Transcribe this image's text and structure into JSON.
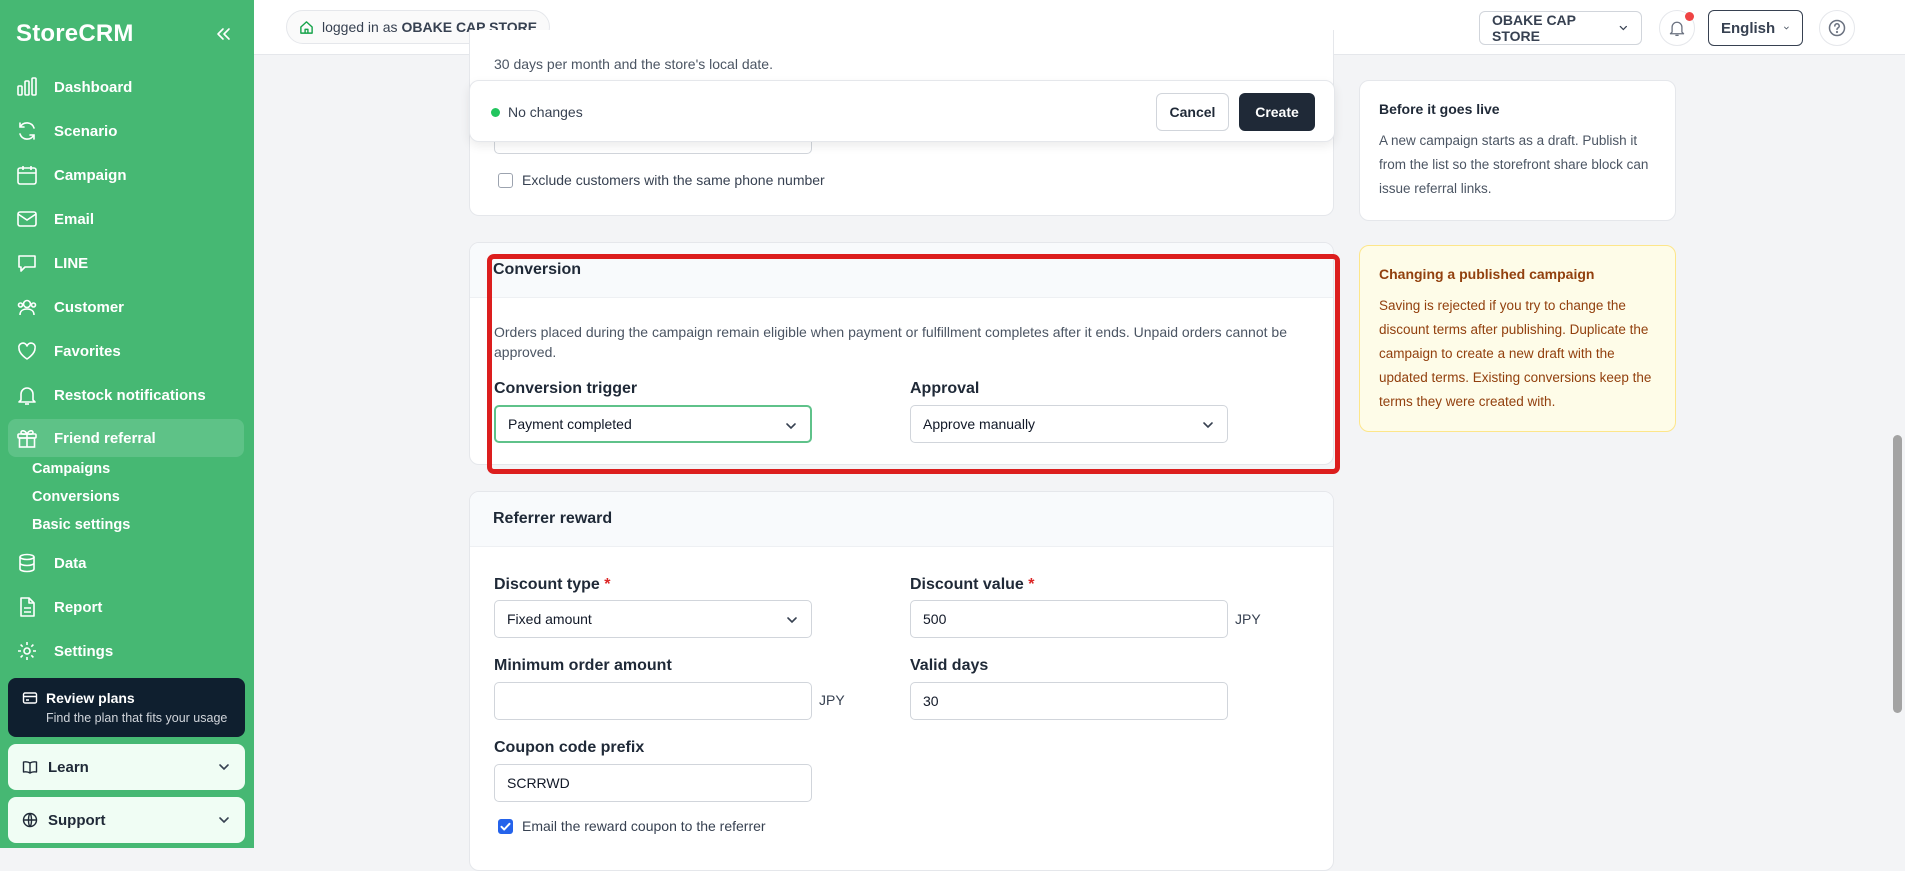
{
  "app": {
    "name": "StoreCRM"
  },
  "sidebar": {
    "items": [
      {
        "label": "Dashboard"
      },
      {
        "label": "Scenario"
      },
      {
        "label": "Campaign"
      },
      {
        "label": "Email"
      },
      {
        "label": "LINE"
      },
      {
        "label": "Customer"
      },
      {
        "label": "Favorites"
      },
      {
        "label": "Restock notifications"
      },
      {
        "label": "Friend referral"
      },
      {
        "label": "Data"
      },
      {
        "label": "Report"
      },
      {
        "label": "Settings"
      }
    ],
    "subitems": [
      {
        "label": "Campaigns"
      },
      {
        "label": "Conversions"
      },
      {
        "label": "Basic settings"
      }
    ],
    "plans": {
      "title": "Review plans",
      "subtitle": "Find the plan that fits your usage"
    },
    "learn": "Learn",
    "support": "Support"
  },
  "topbar": {
    "login_prefix": "logged in as",
    "store_name": "OBAKE CAP STORE",
    "store_select": "OBAKE CAP STORE",
    "language": "English"
  },
  "top_card": {
    "note": "30 days per month and the store's local date.",
    "exclude_label": "Exclude customers with the same phone number"
  },
  "savebar": {
    "status": "No changes",
    "cancel": "Cancel",
    "create": "Create"
  },
  "conversion": {
    "heading": "Conversion",
    "description": "Orders placed during the campaign remain eligible when payment or fulfillment completes after it ends. Unpaid orders cannot be approved.",
    "trigger_label": "Conversion trigger",
    "trigger_value": "Payment completed",
    "approval_label": "Approval",
    "approval_value": "Approve manually"
  },
  "referrer_reward": {
    "heading": "Referrer reward",
    "discount_type_label": "Discount type",
    "discount_type_value": "Fixed amount",
    "discount_value_label": "Discount value",
    "discount_value": "500",
    "currency": "JPY",
    "min_order_label": "Minimum order amount",
    "min_order_value": "",
    "valid_days_label": "Valid days",
    "valid_days_value": "30",
    "coupon_prefix_label": "Coupon code prefix",
    "coupon_prefix_value": "SCRRWD",
    "email_coupon_label": "Email the reward coupon to the referrer",
    "required_mark": "*"
  },
  "info_cards": {
    "before_live": {
      "title": "Before it goes live",
      "body": "A new campaign starts as a draft. Publish it from the list so the storefront share block can issue referral links."
    },
    "changing": {
      "title": "Changing a published campaign",
      "body": "Saving is rejected if you try to change the discount terms after publishing. Duplicate the campaign to create a new draft with the updated terms. Existing conversions keep the terms they were created with."
    }
  },
  "colors": {
    "sidebar_bg": "#46b873",
    "highlight": "#dc1e1e",
    "primary_dark": "#1f2937",
    "status_dot": "#22c55e",
    "notice_bg": "#fefce8",
    "notice_text": "#92400e"
  }
}
